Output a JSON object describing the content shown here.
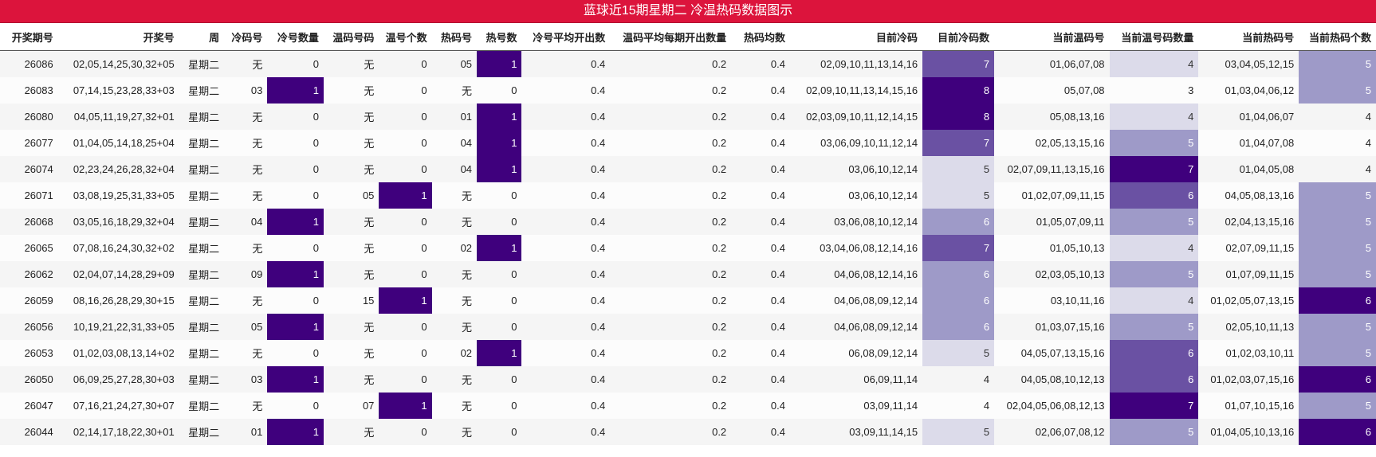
{
  "title": "蓝球近15期星期二 冷温热码数据图示",
  "columns": [
    "开奖期号",
    "开奖号",
    "周",
    "冷码号",
    "冷号数量",
    "温码号码",
    "温号个数",
    "热码号",
    "热号数",
    "冷号平均开出数",
    "温码平均每期开出数量",
    "热码均数",
    "目前冷码",
    "目前冷码数",
    "当前温码号",
    "当前温号码数量",
    "当前热码号",
    "当前热码个数"
  ],
  "rows": [
    [
      "26086",
      "02,05,14,25,30,32+05",
      "星期二",
      "无",
      "0",
      "无",
      "0",
      "05",
      "1",
      "0.4",
      "0.2",
      "0.4",
      "02,09,10,11,13,14,16",
      "7",
      "01,06,07,08",
      "4",
      "03,04,05,12,15",
      "5"
    ],
    [
      "26083",
      "07,14,15,23,28,33+03",
      "星期二",
      "03",
      "1",
      "无",
      "0",
      "无",
      "0",
      "0.4",
      "0.2",
      "0.4",
      "02,09,10,11,13,14,15,16",
      "8",
      "05,07,08",
      "3",
      "01,03,04,06,12",
      "5"
    ],
    [
      "26080",
      "04,05,11,19,27,32+01",
      "星期二",
      "无",
      "0",
      "无",
      "0",
      "01",
      "1",
      "0.4",
      "0.2",
      "0.4",
      "02,03,09,10,11,12,14,15",
      "8",
      "05,08,13,16",
      "4",
      "01,04,06,07",
      "4"
    ],
    [
      "26077",
      "01,04,05,14,18,25+04",
      "星期二",
      "无",
      "0",
      "无",
      "0",
      "04",
      "1",
      "0.4",
      "0.2",
      "0.4",
      "03,06,09,10,11,12,14",
      "7",
      "02,05,13,15,16",
      "5",
      "01,04,07,08",
      "4"
    ],
    [
      "26074",
      "02,23,24,26,28,32+04",
      "星期二",
      "无",
      "0",
      "无",
      "0",
      "04",
      "1",
      "0.4",
      "0.2",
      "0.4",
      "03,06,10,12,14",
      "5",
      "02,07,09,11,13,15,16",
      "7",
      "01,04,05,08",
      "4"
    ],
    [
      "26071",
      "03,08,19,25,31,33+05",
      "星期二",
      "无",
      "0",
      "05",
      "1",
      "无",
      "0",
      "0.4",
      "0.2",
      "0.4",
      "03,06,10,12,14",
      "5",
      "01,02,07,09,11,15",
      "6",
      "04,05,08,13,16",
      "5"
    ],
    [
      "26068",
      "03,05,16,18,29,32+04",
      "星期二",
      "04",
      "1",
      "无",
      "0",
      "无",
      "0",
      "0.4",
      "0.2",
      "0.4",
      "03,06,08,10,12,14",
      "6",
      "01,05,07,09,11",
      "5",
      "02,04,13,15,16",
      "5"
    ],
    [
      "26065",
      "07,08,16,24,30,32+02",
      "星期二",
      "无",
      "0",
      "无",
      "0",
      "02",
      "1",
      "0.4",
      "0.2",
      "0.4",
      "03,04,06,08,12,14,16",
      "7",
      "01,05,10,13",
      "4",
      "02,07,09,11,15",
      "5"
    ],
    [
      "26062",
      "02,04,07,14,28,29+09",
      "星期二",
      "09",
      "1",
      "无",
      "0",
      "无",
      "0",
      "0.4",
      "0.2",
      "0.4",
      "04,06,08,12,14,16",
      "6",
      "02,03,05,10,13",
      "5",
      "01,07,09,11,15",
      "5"
    ],
    [
      "26059",
      "08,16,26,28,29,30+15",
      "星期二",
      "无",
      "0",
      "15",
      "1",
      "无",
      "0",
      "0.4",
      "0.2",
      "0.4",
      "04,06,08,09,12,14",
      "6",
      "03,10,11,16",
      "4",
      "01,02,05,07,13,15",
      "6"
    ],
    [
      "26056",
      "10,19,21,22,31,33+05",
      "星期二",
      "05",
      "1",
      "无",
      "0",
      "无",
      "0",
      "0.4",
      "0.2",
      "0.4",
      "04,06,08,09,12,14",
      "6",
      "01,03,07,15,16",
      "5",
      "02,05,10,11,13",
      "5"
    ],
    [
      "26053",
      "01,02,03,08,13,14+02",
      "星期二",
      "无",
      "0",
      "无",
      "0",
      "02",
      "1",
      "0.4",
      "0.2",
      "0.4",
      "06,08,09,12,14",
      "5",
      "04,05,07,13,15,16",
      "6",
      "01,02,03,10,11",
      "5"
    ],
    [
      "26050",
      "06,09,25,27,28,30+03",
      "星期二",
      "03",
      "1",
      "无",
      "0",
      "无",
      "0",
      "0.4",
      "0.2",
      "0.4",
      "06,09,11,14",
      "4",
      "04,05,08,10,12,13",
      "6",
      "01,02,03,07,15,16",
      "6"
    ],
    [
      "26047",
      "07,16,21,24,27,30+07",
      "星期二",
      "无",
      "0",
      "07",
      "1",
      "无",
      "0",
      "0.4",
      "0.2",
      "0.4",
      "03,09,11,14",
      "4",
      "02,04,05,06,08,12,13",
      "7",
      "01,07,10,15,16",
      "5"
    ],
    [
      "26044",
      "02,14,17,18,22,30+01",
      "星期二",
      "01",
      "1",
      "无",
      "0",
      "无",
      "0",
      "0.4",
      "0.2",
      "0.4",
      "03,09,11,14,15",
      "5",
      "02,06,07,08,12",
      "5",
      "01,04,05,10,13,16",
      "6"
    ]
  ],
  "colors": {
    "title_bg": "#dc143c",
    "level_1": "#dcdbea",
    "level_2": "#9e9ac8",
    "level_3": "#6a51a3",
    "level_4": "#3f007d"
  }
}
